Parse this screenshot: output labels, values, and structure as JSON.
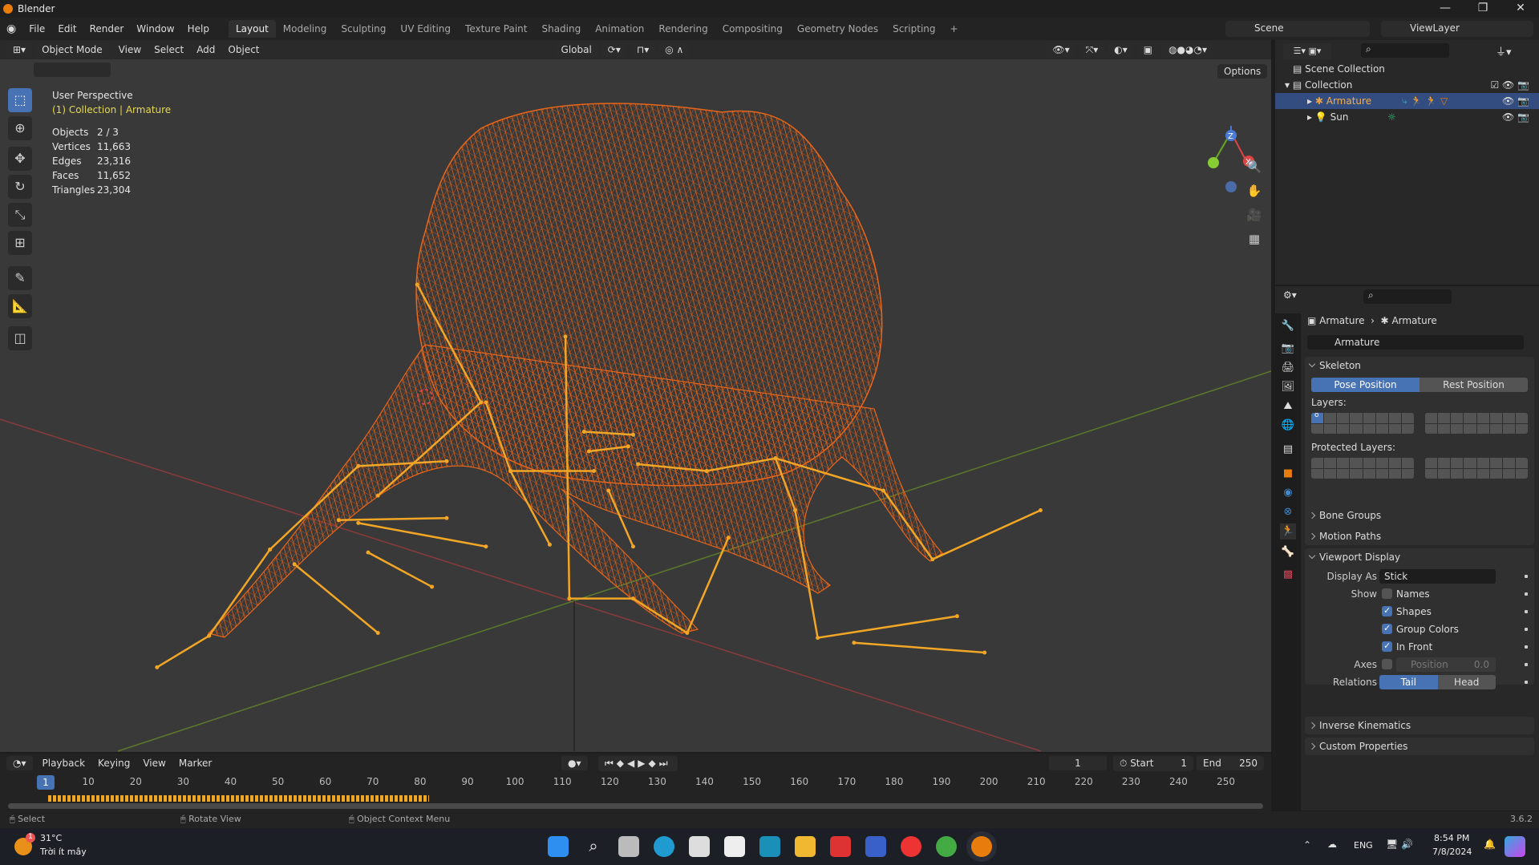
{
  "window": {
    "title": "Blender",
    "minimize": "—",
    "maximize": "❐",
    "close": "✕"
  },
  "menu": [
    "File",
    "Edit",
    "Render",
    "Window",
    "Help"
  ],
  "workspaces": [
    "Layout",
    "Modeling",
    "Sculpting",
    "UV Editing",
    "Texture Paint",
    "Shading",
    "Animation",
    "Rendering",
    "Compositing",
    "Geometry Nodes",
    "Scripting",
    "+"
  ],
  "scene": {
    "name": "Scene",
    "view_layer": "ViewLayer"
  },
  "viewport_header": {
    "mode": "Object Mode",
    "menus": [
      "View",
      "Select",
      "Add",
      "Object"
    ],
    "orientation": "Global",
    "options": "Options"
  },
  "overlay": {
    "view": "User Perspective",
    "context": "(1) Collection | Armature",
    "stats": [
      {
        "label": "Objects",
        "value": "2 / 3"
      },
      {
        "label": "Vertices",
        "value": "11,663"
      },
      {
        "label": "Edges",
        "value": "23,316"
      },
      {
        "label": "Faces",
        "value": "11,652"
      },
      {
        "label": "Triangles",
        "value": "23,304"
      }
    ]
  },
  "gizmo": {
    "z": "Z",
    "x": "X"
  },
  "outliner": {
    "root": "Scene Collection",
    "collection": "Collection",
    "items": [
      {
        "name": "Armature",
        "selected": true
      },
      {
        "name": "Sun",
        "selected": false
      }
    ]
  },
  "properties": {
    "breadcrumb": [
      "Armature",
      "Armature"
    ],
    "datablock": "Armature",
    "skeleton": {
      "title": "Skeleton",
      "pose": "Pose Position",
      "rest": "Rest Position",
      "layers": "Layers:",
      "protected": "Protected Layers:",
      "active_layer_mark": "o"
    },
    "collapsed": [
      "Bone Groups",
      "Motion Paths"
    ],
    "viewport_display": {
      "title": "Viewport Display",
      "display_as_label": "Display As",
      "display_as": "Stick",
      "show_label": "Show",
      "checks": [
        {
          "label": "Names",
          "checked": false
        },
        {
          "label": "Shapes",
          "checked": true
        },
        {
          "label": "Group Colors",
          "checked": true
        },
        {
          "label": "In Front",
          "checked": true
        }
      ],
      "axes_label": "Axes",
      "axes_position_label": "Position",
      "axes_position": "0.0",
      "relations_label": "Relations",
      "tail": "Tail",
      "head": "Head"
    },
    "collapsed_bottom": [
      "Inverse Kinematics",
      "Custom Properties"
    ]
  },
  "timeline": {
    "menus": [
      "Playback",
      "Keying",
      "View",
      "Marker"
    ],
    "current_frame": "1",
    "start_label": "Start",
    "start": "1",
    "end_label": "End",
    "end": "250",
    "ticks": [
      "10",
      "20",
      "30",
      "40",
      "50",
      "60",
      "70",
      "80",
      "90",
      "100",
      "110",
      "120",
      "130",
      "140",
      "150",
      "160",
      "170",
      "180",
      "190",
      "200",
      "210",
      "220",
      "230",
      "240",
      "250"
    ]
  },
  "status": {
    "select": "Select",
    "rotate": "Rotate View",
    "context": "Object Context Menu",
    "version": "3.6.2"
  },
  "taskbar": {
    "temp": "31°C",
    "weather": "Trời ít mây",
    "badge": "1",
    "lang": "ENG",
    "time": "8:54 PM",
    "date": "7/8/2024"
  },
  "colors": {
    "accent": "#4772b3",
    "selection": "#f2a626",
    "wire": "#e8661a"
  }
}
